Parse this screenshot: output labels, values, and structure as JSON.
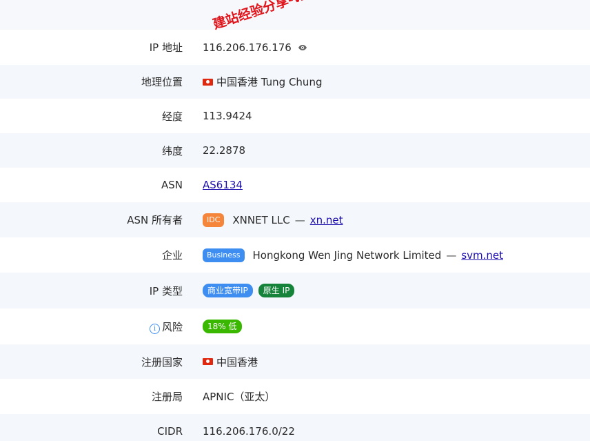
{
  "rows": [
    {
      "label": "IP 地址",
      "value": "116.206.176.176"
    },
    {
      "label": "地理位置",
      "value": "中国香港 Tung Chung"
    },
    {
      "label": "经度",
      "value": "113.9424"
    },
    {
      "label": "纬度",
      "value": "22.2878"
    },
    {
      "label": "ASN",
      "link": "AS6134"
    },
    {
      "label": "ASN 所有者",
      "badge": "IDC",
      "value": "XNNET LLC",
      "separator": "—",
      "link": "xn.net"
    },
    {
      "label": "企业",
      "badge": "Business",
      "value": "Hongkong Wen Jing Network Limited",
      "separator": "—",
      "link": "svm.net"
    },
    {
      "label": "IP 类型",
      "tags": [
        "商业宽带IP",
        "原生 IP"
      ]
    },
    {
      "label": "风险",
      "info_icon": "i",
      "tag": "18% 低"
    },
    {
      "label": "注册国家",
      "value": "中国香港"
    },
    {
      "label": "注册局",
      "value": "APNIC（亚太）"
    },
    {
      "label": "CIDR",
      "value": "116.206.176.0/22"
    }
  ],
  "watermark": "建站经验分享-www.w",
  "colors": {
    "link": "#1a0dab",
    "idc_badge": "#f5853b",
    "business_badge": "#3e8ef2",
    "tag_blue": "#3e8ef2",
    "tag_green": "#16833a",
    "risk_tag": "#3ab800",
    "watermark": "#e0151b"
  },
  "icons": {
    "reveal": "eye-icon",
    "flag": "hong-kong-flag-icon",
    "info": "info-icon"
  }
}
